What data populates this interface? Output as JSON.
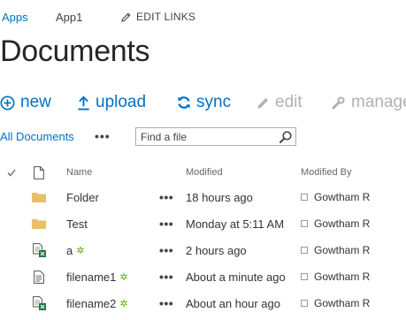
{
  "nav": {
    "apps": "Apps",
    "app1": "App1",
    "edit_links": "EDIT LINKS"
  },
  "page_title": "Documents",
  "toolbar": {
    "new": "new",
    "upload": "upload",
    "sync": "sync",
    "edit": "edit",
    "manage": "manage"
  },
  "view": {
    "name": "All Documents",
    "ellipsis": "•••",
    "search_placeholder": "Find a file"
  },
  "columns": {
    "name": "Name",
    "modified": "Modified",
    "modified_by": "Modified By"
  },
  "rows": [
    {
      "icon": "folder-icon",
      "name": "Folder",
      "new": false,
      "modified": "18 hours ago",
      "modified_by": "Gowtham R"
    },
    {
      "icon": "folder-icon",
      "name": "Test",
      "new": false,
      "modified": "Monday at 5:11 AM",
      "modified_by": "Gowtham R"
    },
    {
      "icon": "excel-file-icon",
      "name": "a",
      "new": true,
      "modified": "2 hours ago",
      "modified_by": "Gowtham R"
    },
    {
      "icon": "text-file-icon",
      "name": "filename1",
      "new": true,
      "modified": "About a minute ago",
      "modified_by": "Gowtham R"
    },
    {
      "icon": "excel-file-icon",
      "name": "filename2",
      "new": true,
      "modified": "About an hour ago",
      "modified_by": "Gowtham R"
    }
  ],
  "row_ellipsis": "•••",
  "colors": {
    "accent": "#0072c6",
    "disabled": "#b1b1b1",
    "folder": "#e8c06a",
    "new_marker": "#5fb000",
    "excel": "#217346"
  }
}
